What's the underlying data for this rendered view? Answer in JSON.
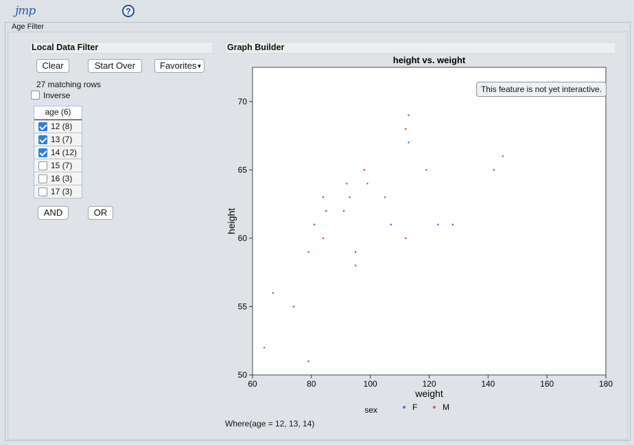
{
  "app": {
    "logo": "jmp",
    "help_icon": "question-icon",
    "window_title": "Age Filter"
  },
  "filter": {
    "header": "Local Data Filter",
    "clear_label": "Clear",
    "start_over_label": "Start Over",
    "favorites_label": "Favorites",
    "matching_rows": "27 matching rows",
    "inverse_label": "Inverse",
    "inverse_checked": false,
    "list_title": "age (6)",
    "items": [
      {
        "label": "12 (8)",
        "checked": true
      },
      {
        "label": "13 (7)",
        "checked": true
      },
      {
        "label": "14 (12)",
        "checked": true
      },
      {
        "label": "15 (7)",
        "checked": false
      },
      {
        "label": "16 (3)",
        "checked": false
      },
      {
        "label": "17 (3)",
        "checked": false
      }
    ],
    "and_label": "AND",
    "or_label": "OR"
  },
  "graph": {
    "header": "Graph Builder",
    "tooltip": "This feature is not yet interactive.",
    "where": "Where(age = 12, 13, 14)"
  },
  "chart_data": {
    "type": "scatter",
    "title": "height vs. weight",
    "xlabel": "weight",
    "ylabel": "height",
    "xlim": [
      60,
      180
    ],
    "ylim": [
      50,
      72.5
    ],
    "xticks": [
      60,
      80,
      100,
      120,
      140,
      160,
      180
    ],
    "yticks": [
      50,
      55,
      60,
      65,
      70
    ],
    "grid": false,
    "legend": {
      "title": "sex",
      "placement": "bottom"
    },
    "series": [
      {
        "name": "F",
        "color": "#3e7bd6",
        "points": [
          [
            67,
            56
          ],
          [
            74,
            55
          ],
          [
            81,
            61
          ],
          [
            84,
            63
          ],
          [
            85,
            62
          ],
          [
            91,
            62
          ],
          [
            95,
            59
          ],
          [
            107,
            61
          ],
          [
            113,
            67
          ],
          [
            123,
            61
          ],
          [
            128,
            61
          ],
          [
            142,
            65
          ],
          [
            145,
            66
          ]
        ]
      },
      {
        "name": "M",
        "color": "#e0525a",
        "points": [
          [
            64,
            52
          ],
          [
            79,
            51
          ],
          [
            79,
            59
          ],
          [
            84,
            60
          ],
          [
            92,
            64
          ],
          [
            93,
            63
          ],
          [
            95,
            58
          ],
          [
            98,
            65
          ],
          [
            99,
            64
          ],
          [
            105,
            63
          ],
          [
            112,
            60
          ],
          [
            112,
            68
          ],
          [
            113,
            69
          ],
          [
            119,
            65
          ]
        ]
      }
    ]
  }
}
